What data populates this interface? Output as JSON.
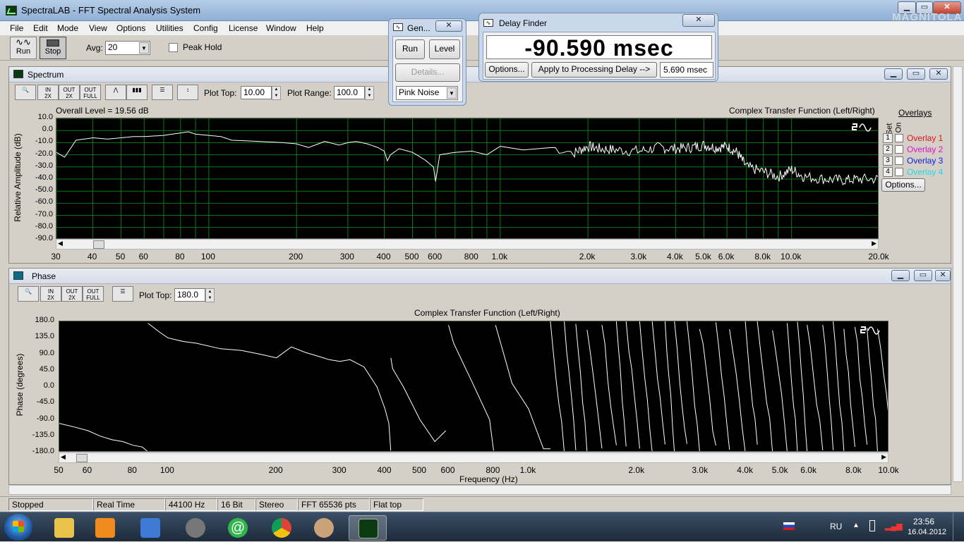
{
  "window": {
    "title": "SpectraLAB - FFT Spectral Analysis System"
  },
  "menu": [
    "File",
    "Edit",
    "Mode",
    "View",
    "Options",
    "Utilities",
    "Config",
    "License",
    "Window",
    "Help"
  ],
  "toolbar": {
    "run_label": "Run",
    "stop_label": "Stop",
    "avg_label": "Avg:",
    "avg_value": "20",
    "peak_hold_label": "Peak Hold"
  },
  "spectrum": {
    "title": "Spectrum",
    "plot_top_label": "Plot Top:",
    "plot_top_value": "10.00",
    "plot_range_label": "Plot Range:",
    "plot_range_value": "100.0",
    "overall_level": "Overall Level = 19.56 dB",
    "chart_title": "Complex Transfer Function (Left/Right)",
    "ylabel": "Relative Amplitude (dB)",
    "xlabel": "Frequency (Hz)",
    "overlays": {
      "title": "Overlays",
      "set_label": "Set",
      "on_label": "On",
      "options_label": "Options...",
      "items": [
        {
          "num": "1",
          "label": "Overlay 1",
          "color": "#e0101a"
        },
        {
          "num": "2",
          "label": "Overlay 2",
          "color": "#e010c8"
        },
        {
          "num": "3",
          "label": "Overlay 3",
          "color": "#1020e0"
        },
        {
          "num": "4",
          "label": "Overlay 4",
          "color": "#20d8e8"
        }
      ]
    }
  },
  "phase": {
    "title": "Phase",
    "plot_top_label": "Plot Top:",
    "plot_top_value": "180.0",
    "chart_title": "Complex Transfer Function (Left/Right)",
    "ylabel": "Phase (degrees)",
    "xlabel": "Frequency (Hz)"
  },
  "chart_data": [
    {
      "type": "line",
      "title": "Complex Transfer Function (Left/Right)",
      "ylabel": "Relative Amplitude (dB)",
      "xlabel": "Frequency (Hz)",
      "x_scale": "log",
      "xlim": [
        30,
        20000
      ],
      "ylim": [
        -90,
        10
      ],
      "grid": true,
      "yticks": [
        "10.0",
        "0.0",
        "-10.0",
        "-20.0",
        "-30.0",
        "-40.0",
        "-50.0",
        "-60.0",
        "-70.0",
        "-80.0",
        "-90.0"
      ],
      "xticks": [
        {
          "v": 30,
          "t": "30"
        },
        {
          "v": 40,
          "t": "40"
        },
        {
          "v": 50,
          "t": "50"
        },
        {
          "v": 60,
          "t": "60"
        },
        {
          "v": 80,
          "t": "80"
        },
        {
          "v": 100,
          "t": "100"
        },
        {
          "v": 200,
          "t": "200"
        },
        {
          "v": 300,
          "t": "300"
        },
        {
          "v": 400,
          "t": "400"
        },
        {
          "v": 500,
          "t": "500"
        },
        {
          "v": 600,
          "t": "600"
        },
        {
          "v": 800,
          "t": "800"
        },
        {
          "v": 1000,
          "t": "1.0k"
        },
        {
          "v": 2000,
          "t": "2.0k"
        },
        {
          "v": 3000,
          "t": "3.0k"
        },
        {
          "v": 4000,
          "t": "4.0k"
        },
        {
          "v": 5000,
          "t": "5.0k"
        },
        {
          "v": 6000,
          "t": "6.0k"
        },
        {
          "v": 8000,
          "t": "8.0k"
        },
        {
          "v": 10000,
          "t": "10.0k"
        },
        {
          "v": 20000,
          "t": "20.0k"
        }
      ],
      "series": [
        {
          "color": "#ffffff",
          "x": [
            30,
            32,
            35,
            40,
            45,
            50,
            55,
            60,
            70,
            80,
            85,
            90,
            100,
            110,
            120,
            150,
            180,
            200,
            220,
            250,
            280,
            300,
            320,
            350,
            380,
            400,
            410,
            420,
            450,
            500,
            550,
            590,
            600,
            620,
            700,
            800,
            900,
            1000,
            1200,
            1500,
            1800,
            2000,
            2200,
            2500,
            3000,
            3500,
            4000,
            4500,
            5000,
            5500,
            6000,
            6500,
            7000,
            8000,
            9000,
            10000,
            11000,
            13000,
            15000,
            17000,
            20000
          ],
          "y": [
            -18,
            -22,
            -8,
            -6,
            -7,
            -6,
            -5,
            -5,
            -4,
            -2,
            -1,
            -3,
            -4,
            -5,
            -8,
            -9,
            -10,
            -11,
            -14,
            -9,
            -12,
            -10,
            -9,
            -11,
            -14,
            -17,
            -25,
            -20,
            -15,
            -18,
            -24,
            -30,
            -42,
            -20,
            -18,
            -17,
            -20,
            -13,
            -16,
            -14,
            -18,
            -13,
            -15,
            -16,
            -17,
            -14,
            -15,
            -14,
            -12,
            -14,
            -13,
            -18,
            -30,
            -34,
            -38,
            -32,
            -38,
            -40,
            -41,
            -40,
            -40
          ]
        }
      ]
    },
    {
      "type": "line",
      "title": "Complex Transfer Function (Left/Right)",
      "ylabel": "Phase (degrees)",
      "xlabel": "Frequency (Hz)",
      "x_scale": "log",
      "xlim": [
        50,
        10000
      ],
      "ylim": [
        -180,
        180
      ],
      "grid": false,
      "yticks": [
        "180.0",
        "135.0",
        "90.0",
        "45.0",
        "0.0",
        "-45.0",
        "-90.0",
        "-135.0",
        "-180.0"
      ],
      "xticks": [
        {
          "v": 50,
          "t": "50"
        },
        {
          "v": 60,
          "t": "60"
        },
        {
          "v": 80,
          "t": "80"
        },
        {
          "v": 100,
          "t": "100"
        },
        {
          "v": 200,
          "t": "200"
        },
        {
          "v": 300,
          "t": "300"
        },
        {
          "v": 400,
          "t": "400"
        },
        {
          "v": 500,
          "t": "500"
        },
        {
          "v": 600,
          "t": "600"
        },
        {
          "v": 800,
          "t": "800"
        },
        {
          "v": 1000,
          "t": "1.0k"
        },
        {
          "v": 2000,
          "t": "2.0k"
        },
        {
          "v": 3000,
          "t": "3.0k"
        },
        {
          "v": 4000,
          "t": "4.0k"
        },
        {
          "v": 5000,
          "t": "5.0k"
        },
        {
          "v": 6000,
          "t": "6.0k"
        },
        {
          "v": 8000,
          "t": "8.0k"
        },
        {
          "v": 10000,
          "t": "10.0k"
        }
      ],
      "series": [
        {
          "color": "#ffffff",
          "x": [
            50,
            55,
            60,
            65,
            70,
            75,
            80,
            85,
            88,
            88.1,
            95,
            100,
            110,
            120,
            140,
            160,
            180,
            200,
            220,
            240,
            260,
            280,
            300,
            320,
            350,
            380,
            400,
            410,
            415,
            415.1,
            420,
            450,
            500,
            550,
            590,
            600,
            620,
            700,
            780,
            800,
            810,
            900,
            1000,
            1100,
            1150
          ],
          "y": [
            -100,
            -110,
            -120,
            -135,
            -145,
            -150,
            -160,
            -165,
            -178,
            175,
            150,
            135,
            125,
            120,
            105,
            100,
            90,
            80,
            110,
            95,
            85,
            75,
            70,
            75,
            55,
            0,
            -60,
            -100,
            -175,
            80,
            50,
            0,
            -90,
            -150,
            -120,
            170,
            120,
            10,
            -90,
            -175,
            170,
            10,
            -60,
            -170,
            -170
          ]
        }
      ],
      "wrapping_region": {
        "from_hz": 1150,
        "to_hz": 20000,
        "note_range": [
          -180,
          180
        ]
      }
    }
  ],
  "generator_dialog": {
    "title": "Gen...",
    "run_label": "Run",
    "level_label": "Level",
    "details_label": "Details...",
    "signal_value": "Pink Noise"
  },
  "delay_finder": {
    "title": "Delay Finder",
    "readout": "-90.590 msec",
    "options_label": "Options...",
    "apply_label": "Apply to Processing Delay -->",
    "delay_value": "5.690 msec"
  },
  "status": [
    "Stopped",
    "Real Time",
    "44100 Hz",
    "16 Bit",
    "Stereo",
    "FFT 65536 pts",
    "Flat top"
  ],
  "taskbar": {
    "lang": "RU",
    "time": "23:56",
    "date": "16.04.2012",
    "apps": [
      "explorer-icon",
      "media-player-icon",
      "network-icon",
      "chart-icon",
      "mail-icon",
      "chrome-icon",
      "paint-icon",
      "spectralab-icon"
    ]
  },
  "watermark": "MAGNITOLA"
}
